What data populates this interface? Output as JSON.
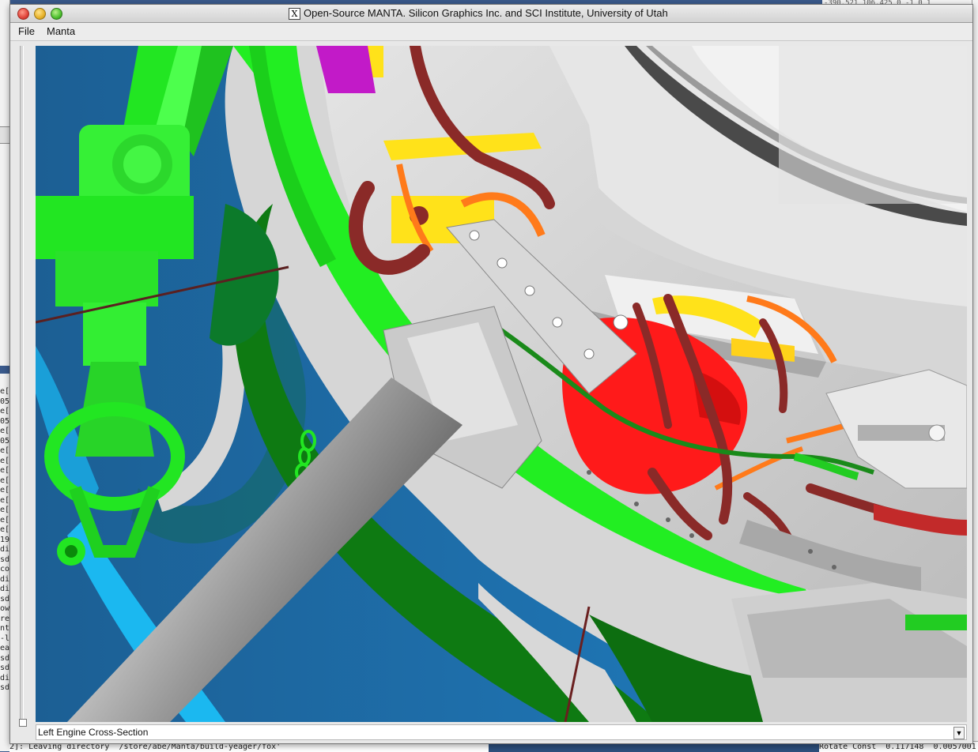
{
  "window": {
    "title": "Open-Source MANTA. Silicon Graphics Inc. and SCI Institute, University of Utah",
    "x_glyph": "X"
  },
  "menu": {
    "file": "File",
    "manta": "Manta"
  },
  "viewport": {
    "description_colors": {
      "frame_green": "#22ee22",
      "nacelle_blue": "#1a6fae",
      "light_blue": "#1bb8f0",
      "dark_green": "#0e7a12",
      "gray_metal": "#c8c8c8",
      "red_part": "#ff1a1a",
      "maroon_pipe": "#8a2a28",
      "yellow_part": "#ffe21a",
      "orange_pipe": "#ff7a1a",
      "magenta_part": "#c21ac8"
    }
  },
  "status": {
    "view_name": "Left Engine Cross-Section"
  },
  "background": {
    "top_right_text": "-390.521 106.425 0 -1 0 1",
    "bottom_left_text": "2]: Leaving directory `/store/abe/Manta/build-yeager/fox'",
    "bottom_right_text": "Rotate Const  0.117148  0.0057001",
    "terminal_lines": [
      "e[3",
      "05-",
      "e[4",
      "05-",
      "e[4",
      "05-",
      "e[4",
      "e[4",
      "e[3",
      "e[4",
      "e[4",
      "e[3",
      "e[4",
      "e[3",
      "e[3",
      "19",
      "dir",
      "sde",
      "cor",
      "dir",
      "dir",
      "sde",
      "ow,",
      "re/",
      "nte",
      "-l",
      "eat",
      "sde",
      "sde",
      "dir",
      "sde"
    ]
  }
}
